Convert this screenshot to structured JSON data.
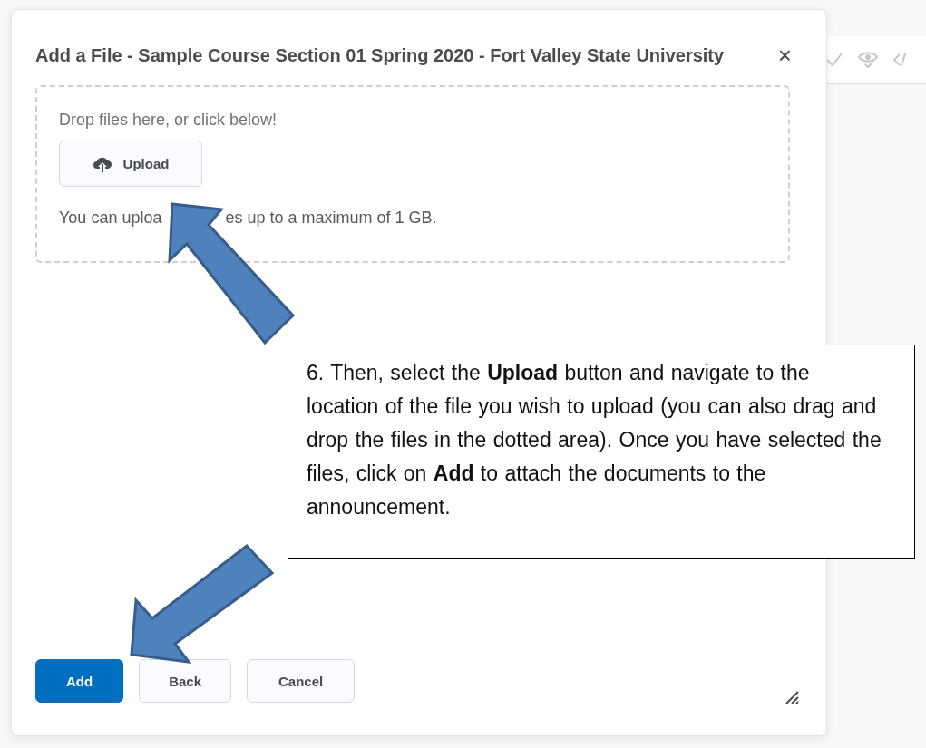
{
  "dialog": {
    "title": "Add a File - Sample Course Section 01 Spring 2020 - Fort Valley State University",
    "close": "×",
    "drop_zone": {
      "prompt": "Drop files here, or click below!",
      "upload_button": "Upload",
      "limit_visible_parts": [
        "You can uploa",
        "es up to a maximum of 1 GB."
      ]
    },
    "buttons": [
      {
        "label": "Add",
        "kind": "primary"
      },
      {
        "label": "Back",
        "kind": "secondary"
      },
      {
        "label": "Cancel",
        "kind": "secondary"
      }
    ]
  },
  "callout": {
    "text": "6. Then, select the **Upload** button and navigate to the location of the file you wish to upload (you can also drag and drop the files in the dotted area).  Once you have selected the files, click on **Add** to attach the documents to the announcement."
  }
}
